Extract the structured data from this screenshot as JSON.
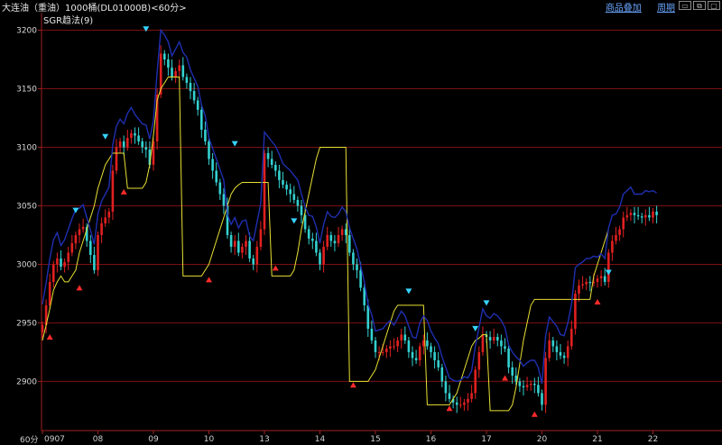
{
  "header": {
    "title": "大连油（重油）1000桶(DL01000B)<60分>",
    "links": [
      "商品叠加",
      "周期"
    ],
    "window_buttons": [
      "minimize-icon",
      "restore-icon",
      "close-icon"
    ]
  },
  "indicator_label": "SGR趋法(9)",
  "period_label": "60分",
  "colors": {
    "up": "#e02020",
    "down": "#34d0d0",
    "support": "#e8e033",
    "resistance": "#1f2fb0",
    "grid": "#7a1010",
    "buy_marker": "#ff2a2a",
    "sell_marker": "#36d4ff"
  },
  "chart_data": {
    "type": "candlestick",
    "title": "",
    "xlabel": "",
    "ylabel": "",
    "ylim": [
      2858,
      3215
    ],
    "y_ticks": [
      2900,
      2950,
      3000,
      3050,
      3100,
      3150,
      3200
    ],
    "x_ticks": [
      {
        "label": "0907",
        "bar": 0
      },
      {
        "label": "08",
        "bar": 15
      },
      {
        "label": "09",
        "bar": 30
      },
      {
        "label": "10",
        "bar": 45
      },
      {
        "label": "13",
        "bar": 60
      },
      {
        "label": "14",
        "bar": 75
      },
      {
        "label": "15",
        "bar": 90
      },
      {
        "label": "16",
        "bar": 105
      },
      {
        "label": "17",
        "bar": 120
      },
      {
        "label": "20",
        "bar": 135
      },
      {
        "label": "21",
        "bar": 150
      },
      {
        "label": "22",
        "bar": 165
      }
    ],
    "close": [
      2948,
      2965,
      2985,
      3000,
      3005,
      2998,
      3002,
      3010,
      3018,
      3025,
      3030,
      3032,
      3020,
      3008,
      2995,
      3025,
      3035,
      3040,
      3045,
      3080,
      3100,
      3105,
      3100,
      3108,
      3112,
      3110,
      3105,
      3100,
      3098,
      3085,
      3105,
      3145,
      3180,
      3175,
      3168,
      3160,
      3165,
      3170,
      3160,
      3155,
      3148,
      3140,
      3132,
      3115,
      3105,
      3090,
      3080,
      3070,
      3060,
      3050,
      3025,
      3015,
      3020,
      3010,
      3015,
      3020,
      3005,
      3000,
      3015,
      3030,
      3095,
      3090,
      3085,
      3080,
      3072,
      3068,
      3064,
      3060,
      3055,
      3050,
      3042,
      3030,
      3022,
      3020,
      3010,
      3000,
      3015,
      3025,
      3020,
      3018,
      3025,
      3030,
      3025,
      3010,
      3000,
      2995,
      2980,
      2965,
      2945,
      2935,
      2925,
      2925,
      2925,
      2928,
      2930,
      2930,
      2935,
      2940,
      2935,
      2925,
      2920,
      2918,
      2930,
      2935,
      2930,
      2925,
      2918,
      2912,
      2900,
      2890,
      2885,
      2882,
      2880,
      2880,
      2882,
      2885,
      2890,
      2910,
      2925,
      2940,
      2938,
      2935,
      2938,
      2935,
      2930,
      2928,
      2912,
      2905,
      2900,
      2896,
      2895,
      2897,
      2898,
      2897,
      2890,
      2880,
      2920,
      2935,
      2930,
      2925,
      2922,
      2920,
      2930,
      2945,
      2975,
      2982,
      2983,
      2985,
      2984,
      2985,
      2988,
      2990,
      2985,
      3010,
      3020,
      3025,
      3030,
      3040,
      3042,
      3044,
      3042,
      3041,
      3040,
      3042,
      3040,
      3045,
      3042
    ],
    "support_line": [
      2935,
      2948,
      2962,
      2978,
      2985,
      2990,
      2985,
      2985,
      2990,
      2995,
      3010,
      3020,
      3030,
      3040,
      3050,
      3065,
      3075,
      3085,
      3090,
      3095,
      3095,
      3095,
      3095,
      3065,
      3065,
      3065,
      3065,
      3065,
      3070,
      3085,
      3110,
      3140,
      3150,
      3155,
      3160,
      3160,
      3160,
      3160,
      2990,
      2990,
      2990,
      2990,
      2990,
      2990,
      2995,
      3000,
      3010,
      3020,
      3030,
      3040,
      3050,
      3060,
      3065,
      3068,
      3070,
      3070,
      3070,
      3070,
      3070,
      3070,
      3070,
      3070,
      2990,
      2990,
      2990,
      2990,
      2990,
      2990,
      2995,
      3010,
      3030,
      3045,
      3060,
      3075,
      3090,
      3100,
      3100,
      3100,
      3100,
      3100,
      3100,
      3100,
      3100,
      2900,
      2900,
      2900,
      2900,
      2900,
      2900,
      2905,
      2910,
      2920,
      2930,
      2940,
      2950,
      2960,
      2965,
      2965,
      2965,
      2965,
      2965,
      2965,
      2965,
      2965,
      2880,
      2880,
      2880,
      2880,
      2880,
      2880,
      2880,
      2885,
      2890,
      2900,
      2910,
      2920,
      2930,
      2935,
      2937,
      2940,
      2940,
      2875,
      2875,
      2875,
      2875,
      2875,
      2875,
      2880,
      2895,
      2915,
      2935,
      2950,
      2965,
      2970,
      2970,
      2970,
      2970,
      2970,
      2970,
      2970,
      2970,
      2970,
      2970,
      2970,
      2970,
      2970,
      2970,
      2970,
      2970,
      2990,
      3000,
      3010,
      3020,
      3030
    ]
  },
  "signals": {
    "buy": [
      {
        "bar": 2,
        "price": 2938
      },
      {
        "bar": 10,
        "price": 2980
      },
      {
        "bar": 22,
        "price": 3062
      },
      {
        "bar": 45,
        "price": 2987
      },
      {
        "bar": 63,
        "price": 2997
      },
      {
        "bar": 84,
        "price": 2897
      },
      {
        "bar": 110,
        "price": 2877
      },
      {
        "bar": 125,
        "price": 2903
      },
      {
        "bar": 133,
        "price": 2872
      },
      {
        "bar": 150,
        "price": 2968
      }
    ],
    "sell": [
      {
        "bar": 9,
        "price": 3046
      },
      {
        "bar": 17,
        "price": 3109
      },
      {
        "bar": 28,
        "price": 3201
      },
      {
        "bar": 52,
        "price": 3103
      },
      {
        "bar": 68,
        "price": 3037
      },
      {
        "bar": 99,
        "price": 2977
      },
      {
        "bar": 117,
        "price": 2945
      },
      {
        "bar": 120,
        "price": 2967
      },
      {
        "bar": 153,
        "price": 2993
      }
    ]
  }
}
